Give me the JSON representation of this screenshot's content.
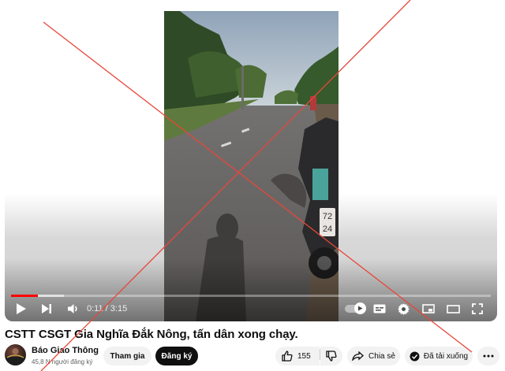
{
  "player": {
    "time_current": "0:11",
    "time_total": "3:15",
    "progress": 0.056,
    "icons": {
      "play": "play-icon",
      "next": "next-icon",
      "volume": "volume-icon",
      "autoplay": "autoplay-toggle",
      "subtitles": "subtitles-icon",
      "settings": "gear-icon",
      "miniplayer": "miniplayer-icon",
      "theater": "theater-icon",
      "fullscreen": "fullscreen-icon"
    }
  },
  "video": {
    "title": "CSTT CSGT Gia Nghĩa Đắk Nông, tấn dân xong chạy.",
    "plate_line1": "72",
    "plate_line2": "24"
  },
  "channel": {
    "name": "Báo Giao Thông",
    "subscribers": "45,8 N người đăng ký",
    "join_label": "Tham gia",
    "subscribe_label": "Đăng ký"
  },
  "actions": {
    "like_count": "155",
    "share_label": "Chia sẻ",
    "download_label": "Đã tải xuống"
  },
  "colors": {
    "progress": "#ff0000",
    "cross_lines": "#e8463a",
    "subscribe_bg": "#0f0f0f",
    "pill_bg": "#f2f2f2"
  }
}
